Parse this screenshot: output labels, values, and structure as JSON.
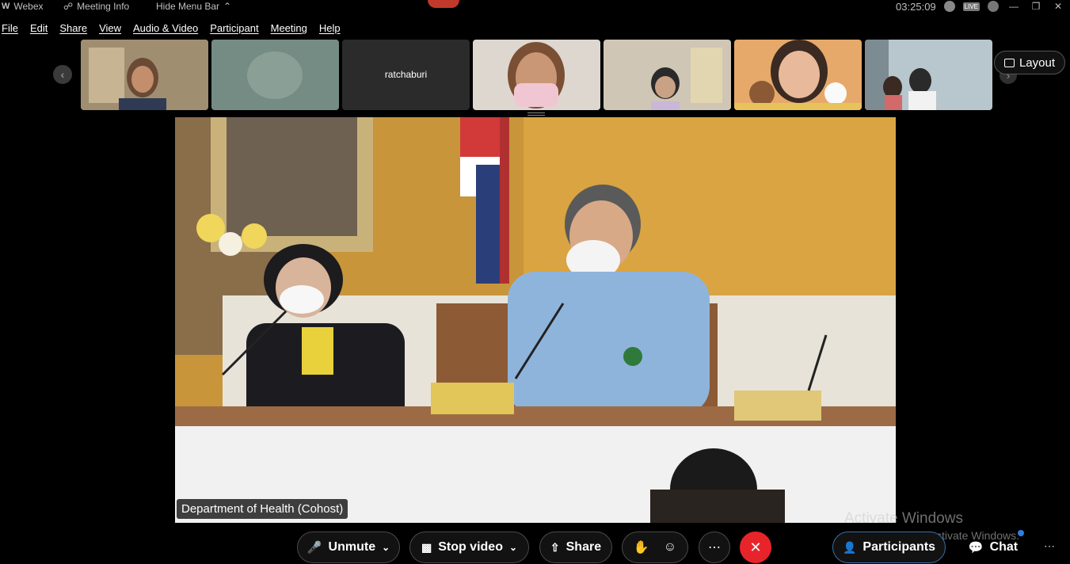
{
  "titlebar": {
    "app": "Webex",
    "meeting_info": "Meeting Info",
    "hide_menu_bar": "Hide Menu Bar",
    "clock": "03:25:09",
    "live_badge": "LIVE"
  },
  "menu": [
    "File",
    "Edit",
    "Share",
    "View",
    "Audio & Video",
    "Participant",
    "Meeting",
    "Help"
  ],
  "thumbnails": [
    {
      "name": "",
      "tone": "#8c7b62"
    },
    {
      "name": "",
      "tone": "#7a9187"
    },
    {
      "name": "ratchaburi",
      "tone": "#2b2b2b"
    },
    {
      "name": "",
      "tone": "#d9d4cf"
    },
    {
      "name": "",
      "tone": "#cfc7b8"
    },
    {
      "name": "",
      "tone": "#e7b86b"
    },
    {
      "name": "",
      "tone": "#b9c8d1"
    }
  ],
  "layout_button": "Layout",
  "stage": {
    "label": "Department of Health (Cohost)"
  },
  "controls": {
    "unmute": "Unmute",
    "stop_video": "Stop video",
    "share": "Share",
    "participants": "Participants",
    "chat": "Chat"
  },
  "watermark": {
    "line1": "Activate Windows",
    "line2": "Go to Settings to activate Windows."
  },
  "colors": {
    "end_call": "#e8242b",
    "accent": "#2f7de1"
  }
}
